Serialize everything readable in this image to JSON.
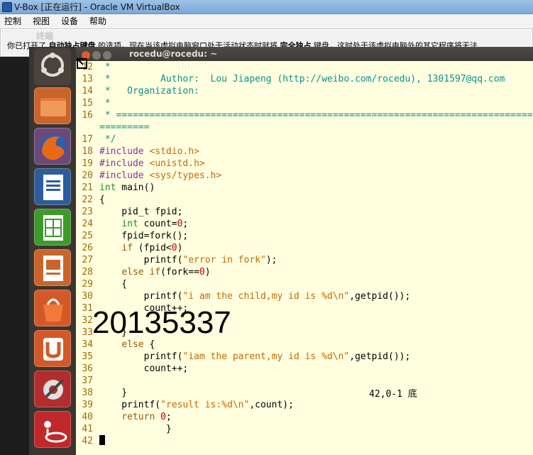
{
  "host": {
    "title": "V-Box [正在运行] - Oracle VM VirtualBox",
    "menu": [
      "控制",
      "视图",
      "设备",
      "帮助"
    ]
  },
  "notification": {
    "ghost_title": "终端",
    "part1": "你已打开了 ",
    "bold1": "自动独占键盘",
    "part2": " 的选项。现在当该虚拟电脑窗口处于活动状态时就将 ",
    "bold2": "完全独占",
    "part3": " 键盘，这时处于该虚拟电脑外的其它程序将无法"
  },
  "terminal": {
    "title": "rocedu@rocedu: ~"
  },
  "launcher": {
    "items": [
      "dash-icon",
      "files-icon",
      "firefox-icon",
      "writer-icon",
      "calc-icon",
      "impress-icon",
      "software-center-icon",
      "ubuntu-one-icon",
      "settings-icon",
      "extra-icon"
    ]
  },
  "code": {
    "lines": [
      {
        "n": "12",
        "t": " *"
      },
      {
        "n": "13",
        "t": " *         Author:  Lou Jiapeng (http://weibo.com/rocedu), 1301597@qq.com"
      },
      {
        "n": "14",
        "t": " *   Organization:"
      },
      {
        "n": "15",
        "t": " *"
      },
      {
        "n": "16",
        "t": " * ============================================================================"
      },
      {
        "n": "",
        "t": "========="
      },
      {
        "n": "17",
        "t": " */"
      },
      {
        "n": "18",
        "t": "#include <stdio.h>"
      },
      {
        "n": "19",
        "t": "#include <unistd.h>"
      },
      {
        "n": "20",
        "t": "#include <sys/types.h>"
      },
      {
        "n": "21",
        "t": "int main()"
      },
      {
        "n": "22",
        "t": "{"
      },
      {
        "n": "23",
        "t": "    pid_t fpid;"
      },
      {
        "n": "24",
        "t": "    int count=0;"
      },
      {
        "n": "25",
        "t": "    fpid=fork();"
      },
      {
        "n": "26",
        "t": "    if (fpid<0)"
      },
      {
        "n": "27",
        "t": "        printf(\"error in fork\");"
      },
      {
        "n": "28",
        "t": "    else if(fork==0)"
      },
      {
        "n": "29",
        "t": "    {"
      },
      {
        "n": "30",
        "t": "        printf(\"i am the child,my id is %d\\n\",getpid());"
      },
      {
        "n": "31",
        "t": "        count++;"
      },
      {
        "n": "32",
        "t": ""
      },
      {
        "n": "33",
        "t": "    }"
      },
      {
        "n": "34",
        "t": "    else {"
      },
      {
        "n": "35",
        "t": "        printf(\"iam the parent,my id is %d\\n\",getpid());"
      },
      {
        "n": "36",
        "t": "        count++;"
      },
      {
        "n": "37",
        "t": ""
      },
      {
        "n": "38",
        "t": "    }"
      },
      {
        "n": "39",
        "t": "    printf(\"result is:%d\\n\",count);"
      },
      {
        "n": "40",
        "t": "    return 0;"
      },
      {
        "n": "41",
        "t": "            }"
      },
      {
        "n": "42",
        "t": ""
      }
    ],
    "status": "42,0-1        底"
  },
  "overlay": {
    "number": "20135337"
  },
  "colors": {
    "editor_bg": "#ffffdf",
    "comment": "#0b8f8f",
    "preproc": "#8a2fb0",
    "type": "#1a8f1a",
    "string": "#c46a00",
    "number": "#c00000",
    "line_number": "#a06a00"
  }
}
